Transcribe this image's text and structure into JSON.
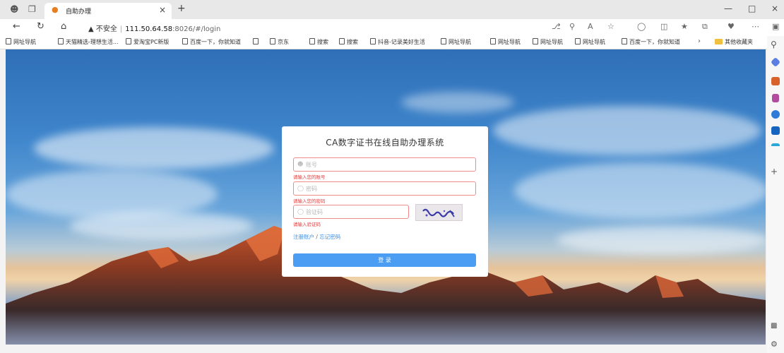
{
  "browser": {
    "tab_title": "自助办理",
    "url_warning": "不安全",
    "url_host": "111.50.64.58",
    "url_path": ":8026/#/login"
  },
  "bookmarks": [
    "网址导航",
    "天猫精选-理想生活...",
    "爱淘宝PC新版",
    "百度一下，你就知道",
    "",
    "京东",
    "搜索",
    "搜索",
    "抖音-记录美好生活",
    "网址导航",
    "网址导航",
    "网址导航",
    "网址导航",
    "百度一下，你就知道"
  ],
  "bookmarks_folder": "其他收藏夹",
  "login": {
    "title": "CA数字证书在线自助办理系统",
    "account_placeholder": "账号",
    "account_error": "请输入您的账号",
    "password_placeholder": "密码",
    "password_error": "请输入您的密码",
    "captcha_placeholder": "验证码",
    "captcha_error": "请输入验证码",
    "register_link": "注册账户",
    "forgot_link": "忘记密码",
    "link_separator": "/",
    "login_button": "登 录"
  },
  "colors": {
    "error": "#e23b3b",
    "field_border": "#f08b8b",
    "link": "#3a8ee6",
    "primary_button": "#4a9df2"
  }
}
